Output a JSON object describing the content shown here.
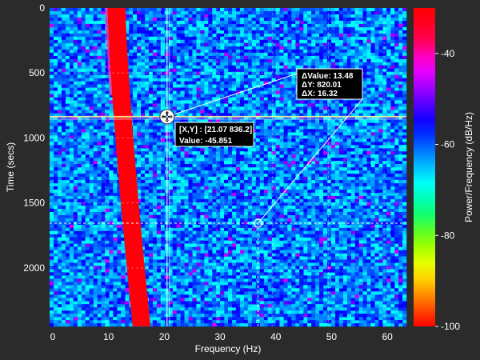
{
  "chart_data": {
    "type": "heatmap",
    "title": "",
    "xlabel": "Frequency (Hz)",
    "ylabel": "Time (secs)",
    "colorbar_label": "Power/Frequency (dB/Hz)",
    "xlim": [
      0,
      64
    ],
    "ylim": [
      2450,
      0
    ],
    "clim": [
      -100,
      -30
    ],
    "x_ticks": [
      0,
      10,
      20,
      30,
      40,
      50,
      60
    ],
    "y_ticks": [
      0,
      500,
      1000,
      1500,
      2000
    ],
    "colorbar_ticks": [
      -40,
      -60,
      -80,
      -100
    ],
    "grid": true,
    "colormap": [
      "#ff0000",
      "#ff8000",
      "#ffff00",
      "#80ff00",
      "#00ff80",
      "#00ffff",
      "#0080ff",
      "#0000ff",
      "#8000ff",
      "#ff00ff",
      "#ff0040",
      "#ff0000"
    ],
    "background_power_db": -62,
    "signal": {
      "description_of_band": "strong tone drifting in frequency",
      "start_freq_hz": 12,
      "end_freq_hz": 16.5,
      "width_hz": 3.2,
      "power_db": -30
    },
    "crosshair": {
      "x": 21.07,
      "y": 836.2,
      "label": "[X,Y] : [21.07 836.2]",
      "value_label": "Value: -45.851"
    },
    "marker2": {
      "x": 37.39,
      "y": 1656.21
    },
    "delta": {
      "value": "ΔValue: 13.48",
      "dy": "ΔY: 820.01",
      "dx": "ΔX: 16.32"
    },
    "colors": {
      "background": "#2b2b2b",
      "crosshair": "#ffffff",
      "tooltip_bg": "#000000",
      "tooltip_border": "#ffffff"
    }
  }
}
